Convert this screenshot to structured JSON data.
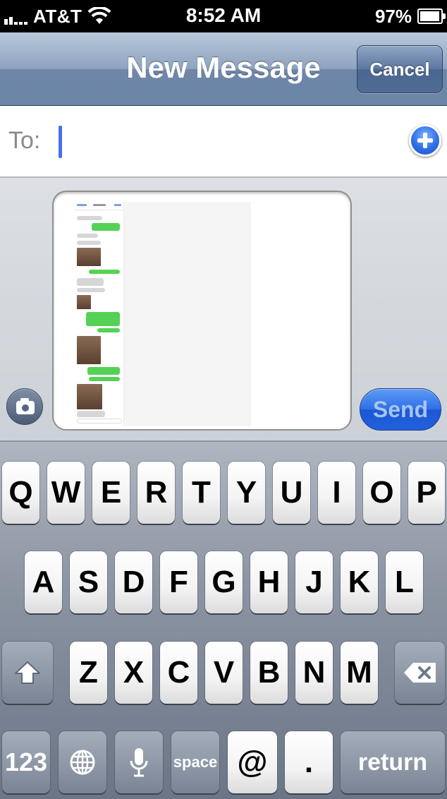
{
  "status_bar": {
    "carrier": "AT&T",
    "time": "8:52 AM",
    "battery_percent": "97%",
    "battery_level": 0.97,
    "icons": [
      "signal-bars-icon",
      "wifi-icon",
      "battery-charging-icon"
    ]
  },
  "nav": {
    "title": "New Message",
    "cancel_label": "Cancel"
  },
  "to_field": {
    "label": "To:",
    "value": "",
    "add_icon": "add-contact-plus-icon"
  },
  "compose": {
    "camera_icon": "camera-icon",
    "attachment": "screenshot-thumbnail",
    "send_label": "Send"
  },
  "keyboard": {
    "row1": [
      "Q",
      "W",
      "E",
      "R",
      "T",
      "Y",
      "U",
      "I",
      "O",
      "P"
    ],
    "row2": [
      "A",
      "S",
      "D",
      "F",
      "G",
      "H",
      "J",
      "K",
      "L"
    ],
    "row3": [
      "Z",
      "X",
      "C",
      "V",
      "B",
      "N",
      "M"
    ],
    "shift_icon": "shift-arrow-icon",
    "delete_icon": "backspace-icon",
    "numbers_label": "123",
    "globe_icon": "globe-icon",
    "mic_icon": "microphone-icon",
    "space_label": "space",
    "at_label": "@",
    "dot_label": ".",
    "return_label": "return"
  },
  "colors": {
    "nav_blue": "#6c86a8",
    "send_blue": "#2f6ee8",
    "cursor_blue": "#4a6ef0",
    "bubble_green": "#55d255"
  }
}
